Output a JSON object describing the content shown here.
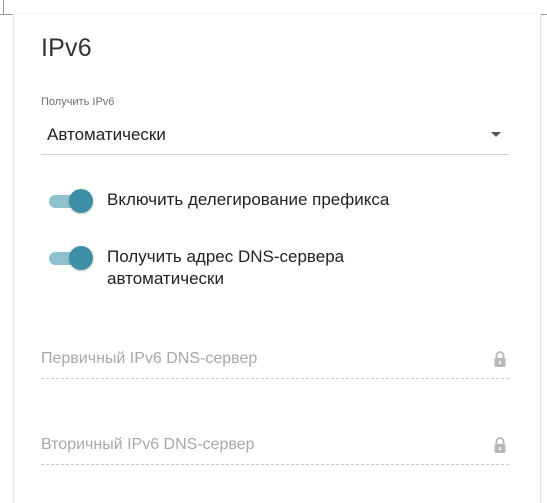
{
  "section": {
    "title": "IPv6"
  },
  "ipv6_mode": {
    "label": "Получить IPv6",
    "value": "Автоматически"
  },
  "toggles": [
    {
      "label": "Включить делегирование префикса",
      "checked": true
    },
    {
      "label": "Получить адрес DNS-сервера автоматически",
      "checked": true
    }
  ],
  "dns_fields": [
    {
      "placeholder": "Первичный IPv6 DNS-сервер",
      "locked": true
    },
    {
      "placeholder": "Вторичный IPv6 DNS-сервер",
      "locked": true
    }
  ],
  "colors": {
    "accent": "#3d8fa6",
    "accent_track": "#8fc0cd"
  }
}
